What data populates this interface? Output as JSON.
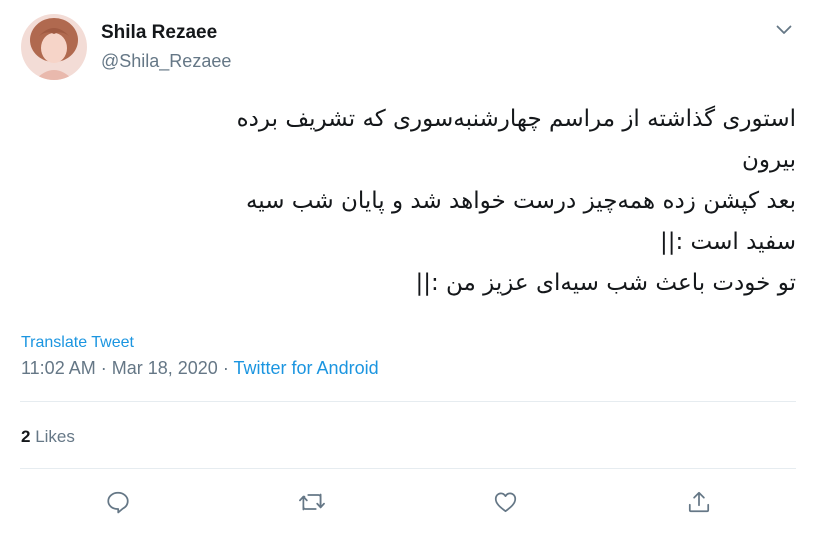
{
  "author": {
    "name": "Shila Rezaee",
    "handle": "@Shila_Rezaee"
  },
  "tweet": {
    "lines": [
      "استوری گذاشته از مراسم چهارشنبه‌سوری که تشریف برده",
      "بیرون",
      "بعد کپشن زده همه‌چیز درست خواهد شد و پایان شب سیه",
      "سفید است :||",
      "تو خودت باعث شب سیه‌ای عزیز من :||"
    ],
    "translate_label": "Translate Tweet",
    "time": "11:02 AM",
    "separator": "·",
    "date": "Mar 18, 2020",
    "source": "Twitter for Android"
  },
  "stats": {
    "likes_count": "2",
    "likes_label": "Likes"
  },
  "actions": [
    "reply-icon",
    "retweet-icon",
    "like-icon",
    "share-icon"
  ],
  "colors": {
    "link": "#1b95e0",
    "secondary_text": "#657786",
    "divider": "#e6ecf0",
    "primary_text": "#14171a"
  }
}
